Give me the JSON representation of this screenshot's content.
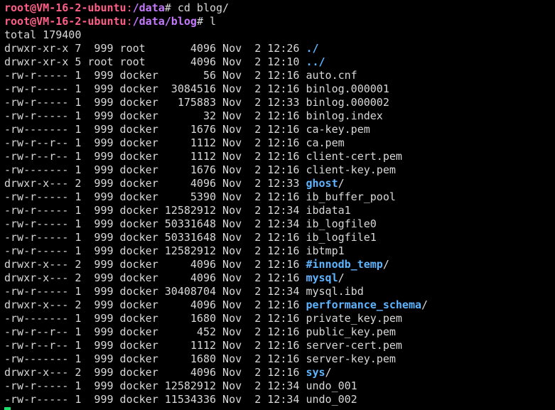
{
  "prompts": [
    {
      "user": "root@VM-16-2-ubuntu",
      "sep": ":",
      "path": "/data",
      "symbol": "#",
      "command": " cd blog/"
    },
    {
      "user": "root@VM-16-2-ubuntu",
      "sep": ":",
      "path": "/data/blog",
      "symbol": "#",
      "command": " l"
    }
  ],
  "total": "total 179400",
  "entries": [
    {
      "meta": "drwxr-xr-x 7  999 root       4096 Nov  2 12:26 ",
      "name": "./",
      "isDir": true
    },
    {
      "meta": "drwxr-xr-x 5 root root       4096 Nov  2 12:10 ",
      "name": "../",
      "isDir": true
    },
    {
      "meta": "-rw-r----- 1  999 docker       56 Nov  2 12:16 ",
      "name": "auto.cnf",
      "isDir": false
    },
    {
      "meta": "-rw-r----- 1  999 docker  3084516 Nov  2 12:16 ",
      "name": "binlog.000001",
      "isDir": false
    },
    {
      "meta": "-rw-r----- 1  999 docker   175883 Nov  2 12:33 ",
      "name": "binlog.000002",
      "isDir": false
    },
    {
      "meta": "-rw-r----- 1  999 docker       32 Nov  2 12:16 ",
      "name": "binlog.index",
      "isDir": false
    },
    {
      "meta": "-rw------- 1  999 docker     1676 Nov  2 12:16 ",
      "name": "ca-key.pem",
      "isDir": false
    },
    {
      "meta": "-rw-r--r-- 1  999 docker     1112 Nov  2 12:16 ",
      "name": "ca.pem",
      "isDir": false
    },
    {
      "meta": "-rw-r--r-- 1  999 docker     1112 Nov  2 12:16 ",
      "name": "client-cert.pem",
      "isDir": false
    },
    {
      "meta": "-rw------- 1  999 docker     1676 Nov  2 12:16 ",
      "name": "client-key.pem",
      "isDir": false
    },
    {
      "meta": "drwxr-x--- 2  999 docker     4096 Nov  2 12:33 ",
      "name": "ghost",
      "isDir": true,
      "suffix": "/"
    },
    {
      "meta": "-rw-r----- 1  999 docker     5390 Nov  2 12:16 ",
      "name": "ib_buffer_pool",
      "isDir": false
    },
    {
      "meta": "-rw-r----- 1  999 docker 12582912 Nov  2 12:34 ",
      "name": "ibdata1",
      "isDir": false
    },
    {
      "meta": "-rw-r----- 1  999 docker 50331648 Nov  2 12:34 ",
      "name": "ib_logfile0",
      "isDir": false
    },
    {
      "meta": "-rw-r----- 1  999 docker 50331648 Nov  2 12:16 ",
      "name": "ib_logfile1",
      "isDir": false
    },
    {
      "meta": "-rw-r----- 1  999 docker 12582912 Nov  2 12:16 ",
      "name": "ibtmp1",
      "isDir": false
    },
    {
      "meta": "drwxr-x--- 2  999 docker     4096 Nov  2 12:16 ",
      "name": "#innodb_temp",
      "isDir": true,
      "suffix": "/"
    },
    {
      "meta": "drwxr-x--- 2  999 docker     4096 Nov  2 12:16 ",
      "name": "mysql",
      "isDir": true,
      "suffix": "/"
    },
    {
      "meta": "-rw-r----- 1  999 docker 30408704 Nov  2 12:34 ",
      "name": "mysql.ibd",
      "isDir": false
    },
    {
      "meta": "drwxr-x--- 2  999 docker     4096 Nov  2 12:16 ",
      "name": "performance_schema",
      "isDir": true,
      "suffix": "/"
    },
    {
      "meta": "-rw------- 1  999 docker     1680 Nov  2 12:16 ",
      "name": "private_key.pem",
      "isDir": false
    },
    {
      "meta": "-rw-r--r-- 1  999 docker      452 Nov  2 12:16 ",
      "name": "public_key.pem",
      "isDir": false
    },
    {
      "meta": "-rw-r--r-- 1  999 docker     1112 Nov  2 12:16 ",
      "name": "server-cert.pem",
      "isDir": false
    },
    {
      "meta": "-rw------- 1  999 docker     1680 Nov  2 12:16 ",
      "name": "server-key.pem",
      "isDir": false
    },
    {
      "meta": "drwxr-x--- 2  999 docker     4096 Nov  2 12:16 ",
      "name": "sys",
      "isDir": true,
      "suffix": "/"
    },
    {
      "meta": "-rw-r----- 1  999 docker 12582912 Nov  2 12:34 ",
      "name": "undo_001",
      "isDir": false
    },
    {
      "meta": "-rw-r----- 1  999 docker 11534336 Nov  2 12:34 ",
      "name": "undo_002",
      "isDir": false
    }
  ],
  "colors": {
    "background": "#000000",
    "text": "#d8d8d8",
    "prompt_user": "#ff5f87",
    "prompt_path": "#c678ff",
    "directory": "#5fb4ff",
    "cursor": "#19e06a"
  }
}
